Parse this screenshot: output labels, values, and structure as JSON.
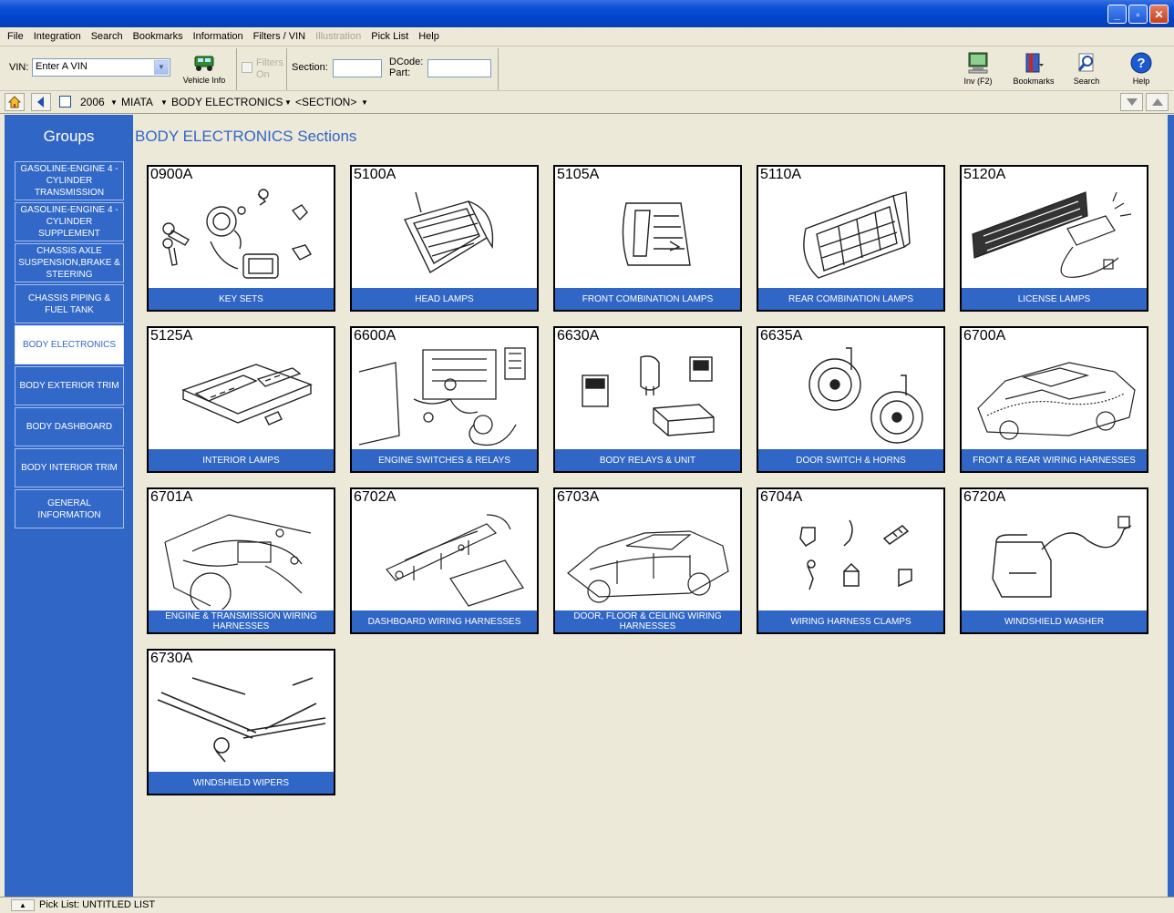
{
  "menubar": {
    "items": [
      {
        "label": "File",
        "enabled": true
      },
      {
        "label": "Integration",
        "enabled": true
      },
      {
        "label": "Search",
        "enabled": true
      },
      {
        "label": "Bookmarks",
        "enabled": true
      },
      {
        "label": "Information",
        "enabled": true
      },
      {
        "label": "Filters / VIN",
        "enabled": true
      },
      {
        "label": "Illustration",
        "enabled": false
      },
      {
        "label": "Pick List",
        "enabled": true
      },
      {
        "label": "Help",
        "enabled": true
      }
    ]
  },
  "toolbar": {
    "vin_label": "VIN:",
    "vin_value": "Enter A VIN",
    "vehicle_info_label": "Vehicle Info",
    "filters_label": "Filters\nOn",
    "section_label": "Section:",
    "dcode_label": "DCode:\nPart:",
    "inv_label": "Inv (F2)",
    "bookmarks_label": "Bookmarks",
    "search_label": "Search",
    "help_label": "Help"
  },
  "breadcrumb": {
    "year": "2006",
    "model": "MIATA",
    "group": "BODY ELECTRONICS",
    "section": "<SECTION>"
  },
  "sidebar": {
    "title": "Groups",
    "items": [
      {
        "label": "GASOLINE-ENGINE 4 -CYLINDER TRANSMISSION",
        "active": false
      },
      {
        "label": "GASOLINE-ENGINE 4 -CYLINDER SUPPLEMENT",
        "active": false
      },
      {
        "label": "CHASSIS AXLE SUSPENSION,BRAKE & STEERING",
        "active": false
      },
      {
        "label": "CHASSIS PIPING & FUEL TANK",
        "active": false
      },
      {
        "label": "BODY ELECTRONICS",
        "active": true
      },
      {
        "label": "BODY EXTERIOR TRIM",
        "active": false
      },
      {
        "label": "BODY DASHBOARD",
        "active": false
      },
      {
        "label": "BODY INTERIOR TRIM",
        "active": false
      },
      {
        "label": "GENERAL INFORMATION",
        "active": false
      }
    ]
  },
  "main": {
    "title": "BODY ELECTRONICS Sections",
    "cards": [
      {
        "code": "0900A",
        "label": "KEY SETS",
        "icon": "key-sets-illustration"
      },
      {
        "code": "5100A",
        "label": "HEAD LAMPS",
        "icon": "head-lamps-illustration"
      },
      {
        "code": "5105A",
        "label": "FRONT COMBINATION LAMPS",
        "icon": "front-combination-lamps-illustration"
      },
      {
        "code": "5110A",
        "label": "REAR COMBINATION LAMPS",
        "icon": "rear-combination-lamps-illustration"
      },
      {
        "code": "5120A",
        "label": "LICENSE LAMPS",
        "icon": "license-lamps-illustration"
      },
      {
        "code": "5125A",
        "label": "INTERIOR LAMPS",
        "icon": "interior-lamps-illustration"
      },
      {
        "code": "6600A",
        "label": "ENGINE SWITCHES & RELAYS",
        "icon": "engine-switches-illustration"
      },
      {
        "code": "6630A",
        "label": "BODY RELAYS & UNIT",
        "icon": "body-relays-illustration"
      },
      {
        "code": "6635A",
        "label": "DOOR SWITCH & HORNS",
        "icon": "horns-illustration"
      },
      {
        "code": "6700A",
        "label": "FRONT & REAR WIRING HARNESSES",
        "icon": "wiring-car-illustration"
      },
      {
        "code": "6701A",
        "label": "ENGINE & TRANSMISSION WIRING HARNESSES",
        "icon": "engine-wiring-illustration"
      },
      {
        "code": "6702A",
        "label": "DASHBOARD WIRING HARNESSES",
        "icon": "dashboard-wiring-illustration"
      },
      {
        "code": "6703A",
        "label": "DOOR, FLOOR & CEILING WIRING HARNESSES",
        "icon": "door-wiring-illustration"
      },
      {
        "code": "6704A",
        "label": "WIRING HARNESS CLAMPS",
        "icon": "clamps-illustration"
      },
      {
        "code": "6720A",
        "label": "WINDSHIELD WASHER",
        "icon": "washer-illustration"
      },
      {
        "code": "6730A",
        "label": "WINDSHIELD WIPERS",
        "icon": "wipers-illustration"
      }
    ]
  },
  "statusbar": {
    "text": "Pick List: UNTITLED LIST"
  },
  "colors": {
    "accent": "#3066c6",
    "titlebar": "#0a4fd8",
    "chrome": "#ece9d8"
  }
}
